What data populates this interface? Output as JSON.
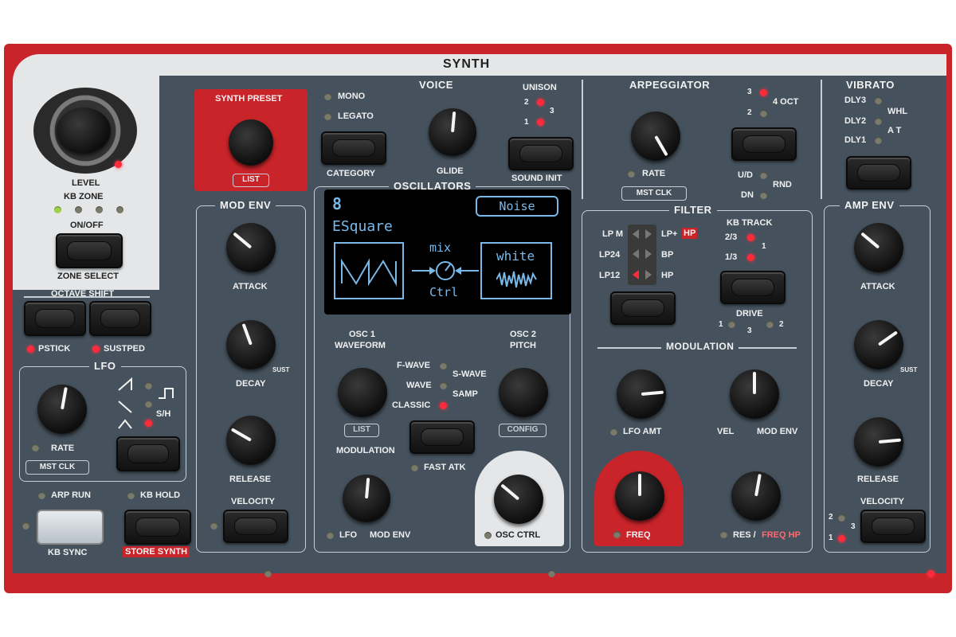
{
  "panel": {
    "title": "SYNTH"
  },
  "left": {
    "level": "LEVEL",
    "kb_zone": "KB ZONE",
    "on_off": "ON/OFF",
    "zone_select": "ZONE SELECT",
    "octave_shift": "OCTAVE SHIFT",
    "pstick": "PSTICK",
    "sustped": "SUSTPED",
    "lfo": "LFO",
    "rate": "RATE",
    "mst_clk": "MST CLK",
    "sh": "S/H",
    "arp_run": "ARP RUN",
    "kb_hold": "KB HOLD",
    "kb_sync": "KB SYNC",
    "store_synth": "STORE SYNTH"
  },
  "preset": {
    "title": "SYNTH PRESET",
    "list": "LIST",
    "category": "CATEGORY"
  },
  "voice": {
    "title": "VOICE",
    "mono": "MONO",
    "legato": "LEGATO",
    "glide": "GLIDE",
    "unison": "UNISON",
    "u2": "2",
    "u3": "3",
    "u1": "1",
    "sound_init": "SOUND INIT"
  },
  "mod_env": {
    "title": "MOD ENV",
    "attack": "ATTACK",
    "decay": "DECAY",
    "sust": "SUST",
    "release": "RELEASE",
    "velocity": "VELOCITY"
  },
  "osc": {
    "title": "OSCILLATORS",
    "screen": {
      "number": "8",
      "badge": "Noise",
      "name": "ESquare",
      "mix": "mix",
      "ctrl": "Ctrl",
      "white": "white"
    },
    "osc1_waveform_1": "OSC 1",
    "osc1_waveform_2": "WAVEFORM",
    "osc2_pitch_1": "OSC 2",
    "osc2_pitch_2": "PITCH",
    "fwave": "F-WAVE",
    "wave": "WAVE",
    "classic": "CLASSIC",
    "swave": "S-WAVE",
    "samp": "SAMP",
    "list": "LIST",
    "config": "CONFIG",
    "modulation": "MODULATION",
    "fast_atk": "FAST ATK",
    "lfo": "LFO",
    "mod_env": "MOD ENV",
    "osc_ctrl": "OSC CTRL"
  },
  "arp": {
    "title": "ARPEGGIATOR",
    "rate": "RATE",
    "mst_clk": "MST CLK",
    "oct3": "3",
    "oct4": "4 OCT",
    "oct2": "2",
    "ud": "U/D",
    "rnd": "RND",
    "dn": "DN"
  },
  "vibrato": {
    "title": "VIBRATO",
    "dly3": "DLY3",
    "dly2": "DLY2",
    "dly1": "DLY1",
    "whl": "WHL",
    "at": "A T"
  },
  "filter": {
    "title": "FILTER",
    "lpm": "LP M",
    "lp24": "LP24",
    "lp12": "LP12",
    "lphp": "LP+",
    "hp_tag": "HP",
    "bp": "BP",
    "hp": "HP",
    "kb_track": "KB TRACK",
    "k23": "2/3",
    "k13": "1/3",
    "k1": "1",
    "drive": "DRIVE",
    "d1": "1",
    "d2": "2",
    "d3": "3",
    "modulation": "MODULATION",
    "lfo_amt": "LFO AMT",
    "vel": "VEL",
    "mod_env": "MOD ENV",
    "freq": "FREQ",
    "res": "RES /",
    "freq_hp": "FREQ HP"
  },
  "amp_env": {
    "title": "AMP ENV",
    "attack": "ATTACK",
    "decay": "DECAY",
    "sust": "SUST",
    "release": "RELEASE",
    "velocity": "VELOCITY",
    "v2": "2",
    "v3": "3",
    "v1": "1"
  }
}
